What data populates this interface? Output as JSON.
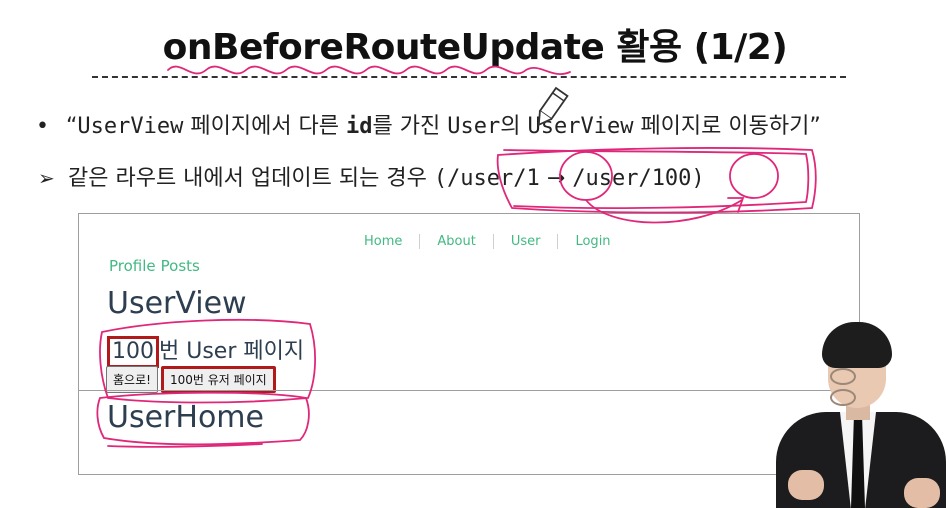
{
  "slide": {
    "title": "onBeforeRouteUpdate 활용 (1/2)",
    "bullet": {
      "marker": "•",
      "open_quote": "“",
      "word1": "UserView",
      "text1": " 페이지에서 다른 ",
      "word2": "id",
      "text2": "를 가진 ",
      "word3": "User",
      "text3": "의 ",
      "word4": "UserView",
      "text4": " 페이지로 이동하기",
      "close_quote": "”"
    },
    "subpoint": {
      "marker": "➢",
      "text": "같은 라우트 내에서 업데이트 되는 경우 ",
      "route_from": "(/user/1",
      "arrow": "→",
      "route_to": "/user/100)"
    }
  },
  "app": {
    "nav": [
      "Home",
      "About",
      "User",
      "Login"
    ],
    "sub_links": [
      "Profile",
      "Posts"
    ],
    "userview_heading": "UserView",
    "user_id": "100",
    "page_suffix": "번 User 페이지",
    "buttons": {
      "home": "홈으로!",
      "user_page": "100번 유저 페이지"
    },
    "userhome_heading": "UserHome"
  },
  "colors": {
    "link_green": "#42b983",
    "heading": "#2c3e50",
    "annotation_pink": "#e0287a",
    "highlight_red": "#b11a1a"
  }
}
